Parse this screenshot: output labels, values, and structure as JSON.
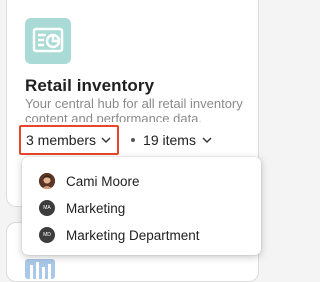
{
  "card": {
    "title": "Retail inventory",
    "description": "Your central hub for all retail inventory content and performance data.",
    "members_label": "3 members",
    "items_label": "19 items",
    "icon_name": "dashboard-chart-icon",
    "icon_bg": "#a9dad6",
    "highlight_color": "#e8462a"
  },
  "members_dropdown": {
    "members": [
      {
        "name": "Cami Moore",
        "avatar": "photo"
      },
      {
        "name": "Marketing",
        "avatar": "MA"
      },
      {
        "name": "Marketing Department",
        "avatar": "MD"
      }
    ]
  }
}
